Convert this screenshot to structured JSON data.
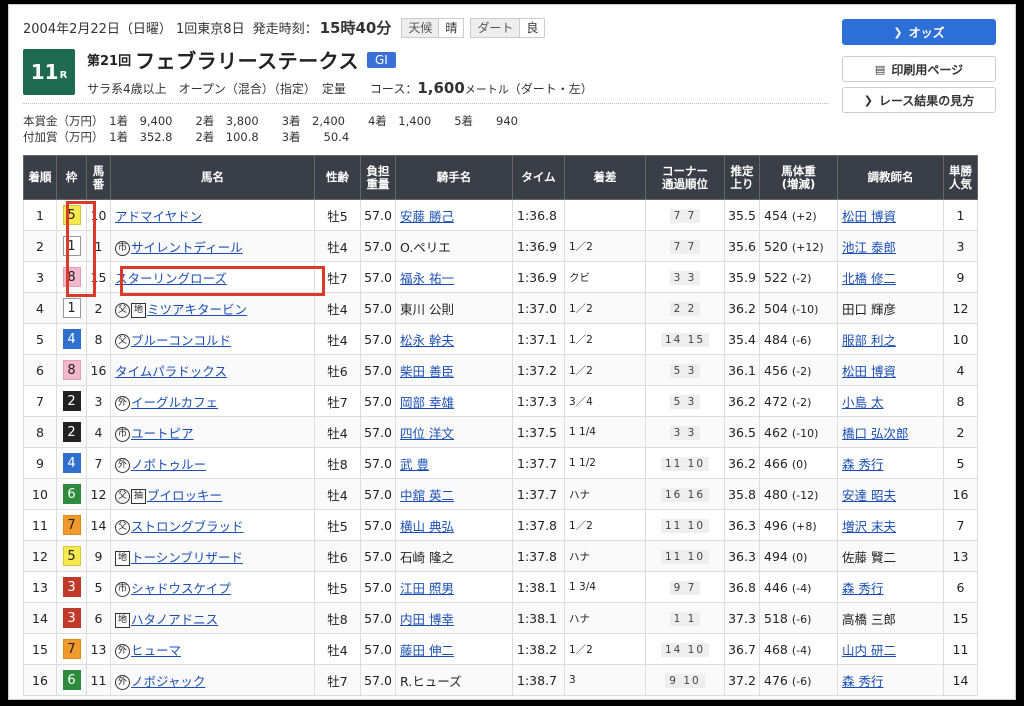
{
  "header": {
    "date_line": "2004年2月22日（日曜） 1回東京8日",
    "start_label": "発走時刻：",
    "start_time": "15時40分",
    "weather_label": "天候",
    "weather": "晴",
    "track_label": "ダート",
    "track_cond": "良"
  },
  "race": {
    "number": "11",
    "suffix": "R",
    "edition": "第21回",
    "name": "フェブラリーステークス",
    "grade": "GI",
    "cond_prefix": "サラ系4歳以上　オープン（混合）（指定）　定量　　コース：",
    "distance": "1,600",
    "unit": "メートル",
    "cond_suffix": "（ダート・左）"
  },
  "prize": {
    "line1": "本賞金（万円）　1着　9,400　　2着　3,800　　3着　2,400　　4着　1,400　　5着　　940",
    "line2": "付加賞（万円）　1着　352.8　　2着　100.8　　3着　　50.4"
  },
  "buttons": {
    "odds": "オッズ",
    "print": "印刷用ページ",
    "howto": "レース結果の見方"
  },
  "columns": [
    "着順",
    "枠",
    "馬番",
    "馬名",
    "性齢",
    "負担重量",
    "騎手名",
    "タイム",
    "着差",
    "コーナー通過順位",
    "推定上り",
    "馬体重(増減)",
    "調教師名",
    "単勝人気"
  ],
  "col_lines": {
    "c2": [
      "馬",
      "番"
    ],
    "c5": [
      "負担",
      "重量"
    ],
    "c9": [
      "コーナー",
      "通過順位"
    ],
    "c10": [
      "推定",
      "上り"
    ],
    "c11": [
      "馬体重",
      "(増減)"
    ],
    "c13": [
      "単勝",
      "人気"
    ]
  },
  "rows": [
    {
      "pos": "1",
      "waku": "5",
      "num": "10",
      "marks": "",
      "horse": "アドマイヤドン",
      "sex": "牡5",
      "wgt": "57.0",
      "jockey": "安藤 勝己",
      "jl": true,
      "time": "1:36.8",
      "diff": "",
      "corner": "7 7",
      "last": "35.5",
      "bw": "454",
      "bwd": "(+2)",
      "trainer": "松田 博資",
      "tl": true,
      "pop": "1"
    },
    {
      "pos": "2",
      "waku": "1",
      "num": "1",
      "marks": "市",
      "horse": "サイレントディール",
      "sex": "牡4",
      "wgt": "57.0",
      "jockey": "O.ペリエ",
      "jl": false,
      "time": "1:36.9",
      "diff": "1／2",
      "corner": "7 7",
      "last": "35.6",
      "bw": "520",
      "bwd": "(+12)",
      "trainer": "池江 泰郎",
      "tl": true,
      "pop": "3"
    },
    {
      "pos": "3",
      "waku": "8",
      "num": "15",
      "marks": "",
      "horse": "スターリングローズ",
      "sex": "牡7",
      "wgt": "57.0",
      "jockey": "福永 祐一",
      "jl": true,
      "time": "1:36.9",
      "diff": "クビ",
      "corner": "3 3",
      "last": "35.9",
      "bw": "522",
      "bwd": "(-2)",
      "trainer": "北橋 修二",
      "tl": true,
      "pop": "9"
    },
    {
      "pos": "4",
      "waku": "1",
      "num": "2",
      "marks": "父地",
      "horse": "ミツアキタービン",
      "sex": "牡4",
      "wgt": "57.0",
      "jockey": "東川 公則",
      "jl": false,
      "time": "1:37.0",
      "diff": "1／2",
      "corner": "2 2",
      "last": "36.2",
      "bw": "504",
      "bwd": "(-10)",
      "trainer": "田口 輝彦",
      "tl": false,
      "pop": "12"
    },
    {
      "pos": "5",
      "waku": "4",
      "num": "8",
      "marks": "父",
      "horse": "ブルーコンコルド",
      "sex": "牡4",
      "wgt": "57.0",
      "jockey": "松永 幹夫",
      "jl": true,
      "time": "1:37.1",
      "diff": "1／2",
      "corner": "14 15",
      "last": "35.4",
      "bw": "484",
      "bwd": "(-6)",
      "trainer": "服部 利之",
      "tl": true,
      "pop": "10"
    },
    {
      "pos": "6",
      "waku": "8",
      "num": "16",
      "marks": "",
      "horse": "タイムパラドックス",
      "sex": "牡6",
      "wgt": "57.0",
      "jockey": "柴田 善臣",
      "jl": true,
      "time": "1:37.2",
      "diff": "1／2",
      "corner": "5 3",
      "last": "36.1",
      "bw": "456",
      "bwd": "(-2)",
      "trainer": "松田 博資",
      "tl": true,
      "pop": "4"
    },
    {
      "pos": "7",
      "waku": "2",
      "num": "3",
      "marks": "外",
      "horse": "イーグルカフェ",
      "sex": "牡7",
      "wgt": "57.0",
      "jockey": "岡部 幸雄",
      "jl": true,
      "time": "1:37.3",
      "diff": "3／4",
      "corner": "5 3",
      "last": "36.2",
      "bw": "472",
      "bwd": "(-2)",
      "trainer": "小島 太",
      "tl": true,
      "pop": "8"
    },
    {
      "pos": "8",
      "waku": "2",
      "num": "4",
      "marks": "市",
      "horse": "ユートピア",
      "sex": "牡4",
      "wgt": "57.0",
      "jockey": "四位 洋文",
      "jl": true,
      "time": "1:37.5",
      "diff": "1 1/4",
      "corner": "3 3",
      "last": "36.5",
      "bw": "462",
      "bwd": "(-10)",
      "trainer": "橋口 弘次郎",
      "tl": true,
      "pop": "2"
    },
    {
      "pos": "9",
      "waku": "4",
      "num": "7",
      "marks": "外",
      "horse": "ノボトゥルー",
      "sex": "牡8",
      "wgt": "57.0",
      "jockey": "武 豊",
      "jl": true,
      "time": "1:37.7",
      "diff": "1 1/2",
      "corner": "11 10",
      "last": "36.2",
      "bw": "466",
      "bwd": "(0)",
      "trainer": "森 秀行",
      "tl": true,
      "pop": "5"
    },
    {
      "pos": "10",
      "waku": "6",
      "num": "12",
      "marks": "父抽",
      "horse": "ブイロッキー",
      "sex": "牡4",
      "wgt": "57.0",
      "jockey": "中舘 英二",
      "jl": true,
      "time": "1:37.7",
      "diff": "ハナ",
      "corner": "16 16",
      "last": "35.8",
      "bw": "480",
      "bwd": "(-12)",
      "trainer": "安達 昭夫",
      "tl": true,
      "pop": "16"
    },
    {
      "pos": "11",
      "waku": "7",
      "num": "14",
      "marks": "父",
      "horse": "ストロングブラッド",
      "sex": "牡5",
      "wgt": "57.0",
      "jockey": "横山 典弘",
      "jl": true,
      "time": "1:37.8",
      "diff": "1／2",
      "corner": "11 10",
      "last": "36.3",
      "bw": "496",
      "bwd": "(+8)",
      "trainer": "増沢 末夫",
      "tl": true,
      "pop": "7"
    },
    {
      "pos": "12",
      "waku": "5",
      "num": "9",
      "marks": "地",
      "horse": "トーシンブリザード",
      "sex": "牡6",
      "wgt": "57.0",
      "jockey": "石崎 隆之",
      "jl": false,
      "time": "1:37.8",
      "diff": "ハナ",
      "corner": "11 10",
      "last": "36.3",
      "bw": "494",
      "bwd": "(0)",
      "trainer": "佐藤 賢二",
      "tl": false,
      "pop": "13"
    },
    {
      "pos": "13",
      "waku": "3",
      "num": "5",
      "marks": "市",
      "horse": "シャドウスケイプ",
      "sex": "牡5",
      "wgt": "57.0",
      "jockey": "江田 照男",
      "jl": true,
      "time": "1:38.1",
      "diff": "1 3/4",
      "corner": "9 7",
      "last": "36.8",
      "bw": "446",
      "bwd": "(-4)",
      "trainer": "森 秀行",
      "tl": true,
      "pop": "6"
    },
    {
      "pos": "14",
      "waku": "3",
      "num": "6",
      "marks": "地",
      "horse": "ハタノアドニス",
      "sex": "牡8",
      "wgt": "57.0",
      "jockey": "内田 博幸",
      "jl": true,
      "time": "1:38.1",
      "diff": "ハナ",
      "corner": "1 1",
      "last": "37.3",
      "bw": "518",
      "bwd": "(-6)",
      "trainer": "高橋 三郎",
      "tl": false,
      "pop": "15"
    },
    {
      "pos": "15",
      "waku": "7",
      "num": "13",
      "marks": "外",
      "horse": "ヒューマ",
      "sex": "牡4",
      "wgt": "57.0",
      "jockey": "藤田 伸二",
      "jl": true,
      "time": "1:38.2",
      "diff": "1／2",
      "corner": "14 10",
      "last": "36.7",
      "bw": "468",
      "bwd": "(-4)",
      "trainer": "山内 研二",
      "tl": true,
      "pop": "11"
    },
    {
      "pos": "16",
      "waku": "6",
      "num": "11",
      "marks": "外",
      "horse": "ノボジャック",
      "sex": "牡7",
      "wgt": "57.0",
      "jockey": "R.ヒューズ",
      "jl": false,
      "time": "1:38.7",
      "diff": "3",
      "corner": "9 10",
      "last": "37.2",
      "bw": "476",
      "bwd": "(-6)",
      "trainer": "森 秀行",
      "tl": true,
      "pop": "14"
    }
  ],
  "colors": {
    "highlight": "#d93a2b",
    "header_bg": "#3a3f47",
    "race_badge": "#1e6b52",
    "grade": "#3a6fd8",
    "odds_button": "#2d6fd6"
  }
}
